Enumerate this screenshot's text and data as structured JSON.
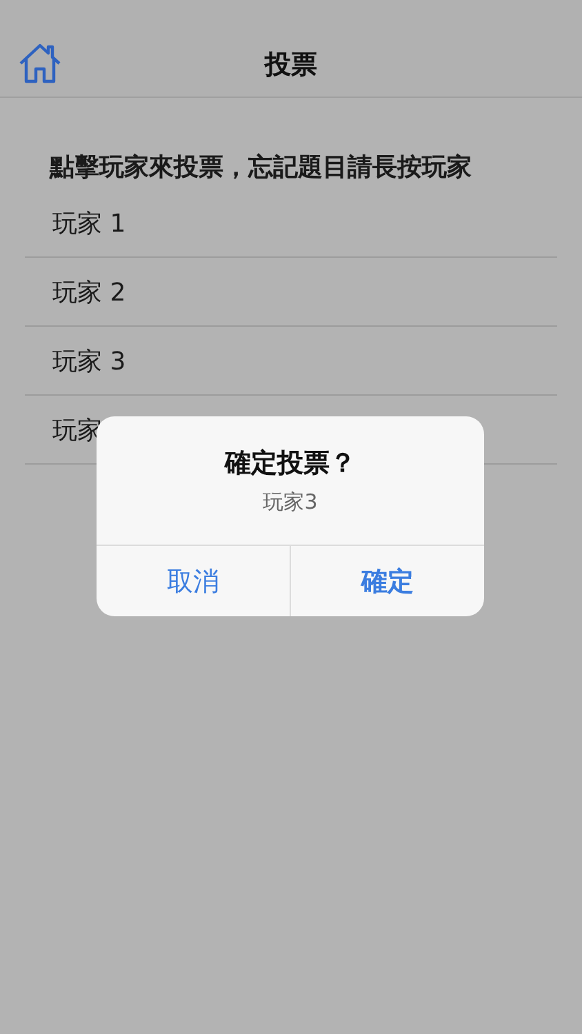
{
  "nav_bar": {
    "title": "投票"
  },
  "instruction": "點擊玩家來投票，忘記題目請長按玩家",
  "players": [
    {
      "label": "玩家 1"
    },
    {
      "label": "玩家 2"
    },
    {
      "label": "玩家 3"
    },
    {
      "label": "玩家"
    }
  ],
  "alert": {
    "title": "確定投票？",
    "message": "玩家3",
    "buttons": [
      {
        "label": "取消",
        "kind": "cancel"
      },
      {
        "label": "確定",
        "kind": "default"
      }
    ]
  }
}
